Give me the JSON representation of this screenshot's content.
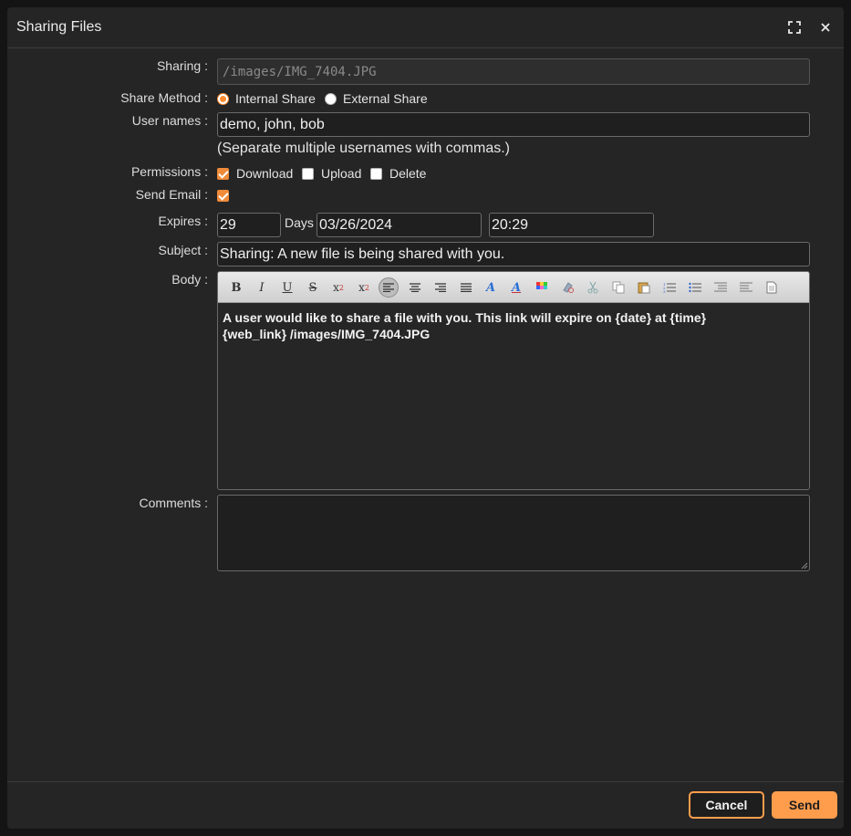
{
  "dialog": {
    "title": "Sharing Files",
    "maximize_icon": "maximize-icon",
    "close_icon": "close-icon"
  },
  "form": {
    "sharing": {
      "label": "Sharing :",
      "value": "/images/IMG_7404.JPG"
    },
    "share_method": {
      "label": "Share Method :",
      "options": [
        {
          "label": "Internal Share",
          "selected": true
        },
        {
          "label": "External Share",
          "selected": false
        }
      ]
    },
    "user_names": {
      "label": "User names :",
      "value": "demo, john, bob",
      "hint": "(Separate multiple usernames with commas.)"
    },
    "permissions": {
      "label": "Permissions :",
      "options": [
        {
          "label": "Download",
          "checked": true
        },
        {
          "label": "Upload",
          "checked": false
        },
        {
          "label": "Delete",
          "checked": false
        }
      ]
    },
    "send_email": {
      "label": "Send Email :",
      "checked": true
    },
    "expires": {
      "label": "Expires :",
      "days_value": "29",
      "days_label": "Days",
      "date_value": "03/26/2024",
      "time_value": "20:29"
    },
    "subject": {
      "label": "Subject :",
      "value": "Sharing: A new file is being shared with you."
    },
    "body": {
      "label": "Body :",
      "line1": "A user would like to share a file with you. This link will expire on {date} at {time}",
      "line2": "{web_link} /images/IMG_7404.JPG"
    },
    "comments": {
      "label": "Comments :",
      "value": ""
    }
  },
  "toolbar": {
    "tools": [
      "bold-icon",
      "italic-icon",
      "underline-icon",
      "strikethrough-icon",
      "subscript-icon",
      "superscript-icon",
      "align-left-icon",
      "align-center-icon",
      "align-right-icon",
      "align-justify-icon",
      "font-color-icon",
      "highlight-color-icon",
      "color-palette-icon",
      "remove-format-icon",
      "cut-icon",
      "copy-icon",
      "paste-icon",
      "ordered-list-icon",
      "unordered-list-icon",
      "outdent-icon",
      "indent-icon",
      "source-icon"
    ]
  },
  "footer": {
    "cancel_label": "Cancel",
    "send_label": "Send"
  },
  "colors": {
    "accent": "#ff9d4d",
    "background": "#252525"
  }
}
